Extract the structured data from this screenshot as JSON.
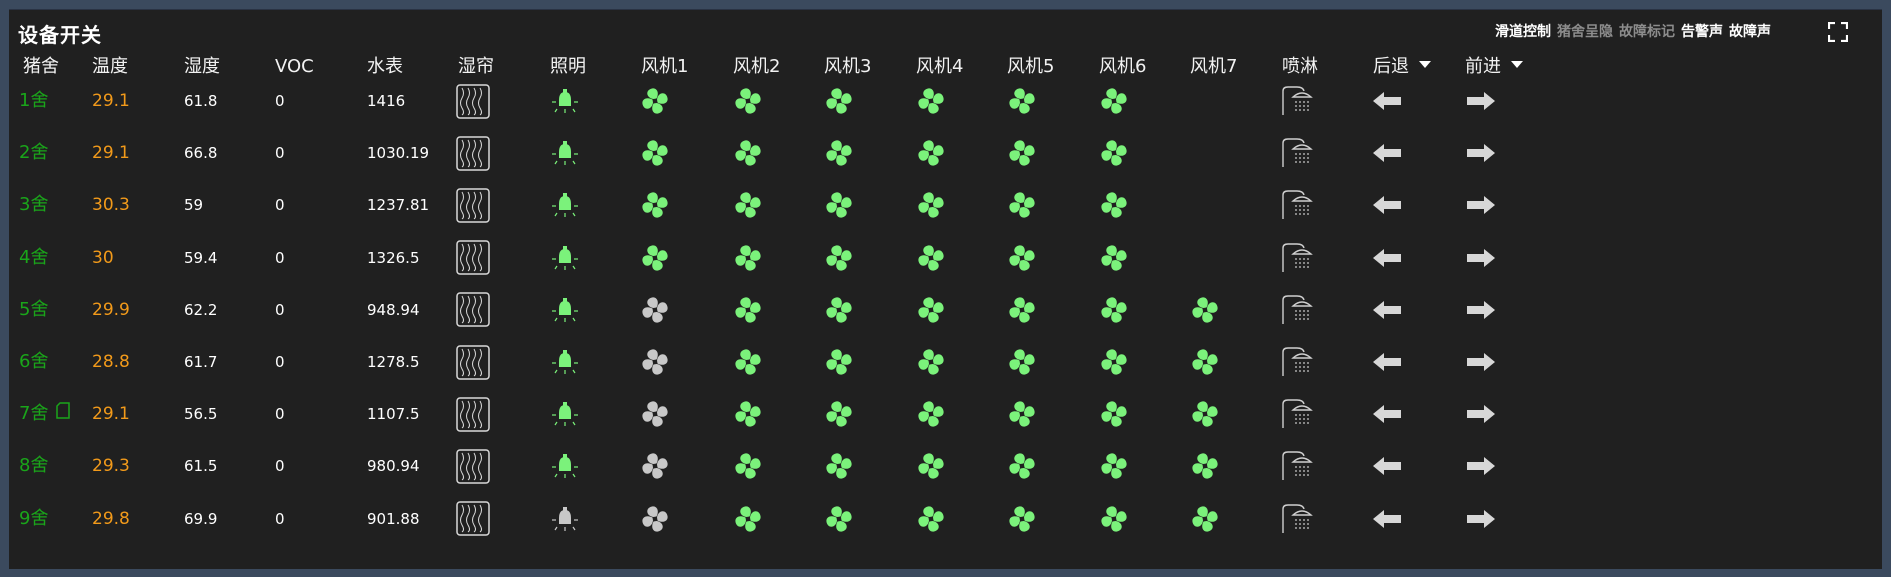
{
  "title": "设备开关",
  "toolbar": {
    "items": [
      {
        "label": "滑道控制",
        "state": "on"
      },
      {
        "label": "猪舍呈隐",
        "state": "off"
      },
      {
        "label": "故障标记",
        "state": "off"
      },
      {
        "label": "告警声",
        "state": "on"
      },
      {
        "label": "故障声",
        "state": "on"
      }
    ],
    "fullscreen_icon": "fullscreen-icon"
  },
  "colors": {
    "background": "#202020",
    "frame": "#3b4a5e",
    "farm_name": "#1aa51a",
    "temperature": "#f29a1a",
    "device_on": "#7bf27b",
    "device_off": "#c8c8c8"
  },
  "headers": {
    "farm": "猪舍",
    "temp": "温度",
    "humidity": "湿度",
    "voc": "VOC",
    "water": "水表",
    "curtain": "湿帘",
    "light": "照明",
    "fan1": "风机1",
    "fan2": "风机2",
    "fan3": "风机3",
    "fan4": "风机4",
    "fan5": "风机5",
    "fan6": "风机6",
    "fan7": "风机7",
    "spray": "喷淋",
    "back": "后退",
    "forward": "前进"
  },
  "rows": [
    {
      "farm": "1舍",
      "temp": "29.1",
      "humidity": "61.8",
      "voc": "0",
      "water": "1416",
      "marker": false,
      "light": "on",
      "fans": [
        "on",
        "on",
        "on",
        "on",
        "on",
        "on",
        null
      ]
    },
    {
      "farm": "2舍",
      "temp": "29.1",
      "humidity": "66.8",
      "voc": "0",
      "water": "1030.19",
      "marker": false,
      "light": "on",
      "fans": [
        "on",
        "on",
        "on",
        "on",
        "on",
        "on",
        null
      ]
    },
    {
      "farm": "3舍",
      "temp": "30.3",
      "humidity": "59",
      "voc": "0",
      "water": "1237.81",
      "marker": false,
      "light": "on",
      "fans": [
        "on",
        "on",
        "on",
        "on",
        "on",
        "on",
        null
      ]
    },
    {
      "farm": "4舍",
      "temp": "30",
      "humidity": "59.4",
      "voc": "0",
      "water": "1326.5",
      "marker": false,
      "light": "on",
      "fans": [
        "on",
        "on",
        "on",
        "on",
        "on",
        "on",
        null
      ]
    },
    {
      "farm": "5舍",
      "temp": "29.9",
      "humidity": "62.2",
      "voc": "0",
      "water": "948.94",
      "marker": false,
      "light": "on",
      "fans": [
        "off",
        "on",
        "on",
        "on",
        "on",
        "on",
        "on"
      ]
    },
    {
      "farm": "6舍",
      "temp": "28.8",
      "humidity": "61.7",
      "voc": "0",
      "water": "1278.5",
      "marker": false,
      "light": "on",
      "fans": [
        "off",
        "on",
        "on",
        "on",
        "on",
        "on",
        "on"
      ]
    },
    {
      "farm": "7舍",
      "temp": "29.1",
      "humidity": "56.5",
      "voc": "0",
      "water": "1107.5",
      "marker": true,
      "light": "on",
      "fans": [
        "off",
        "on",
        "on",
        "on",
        "on",
        "on",
        "on"
      ]
    },
    {
      "farm": "8舍",
      "temp": "29.3",
      "humidity": "61.5",
      "voc": "0",
      "water": "980.94",
      "marker": false,
      "light": "on",
      "fans": [
        "off",
        "on",
        "on",
        "on",
        "on",
        "on",
        "on"
      ]
    },
    {
      "farm": "9舍",
      "temp": "29.8",
      "humidity": "69.9",
      "voc": "0",
      "water": "901.88",
      "marker": false,
      "light": "off",
      "fans": [
        "off",
        "on",
        "on",
        "on",
        "on",
        "on",
        "on"
      ]
    }
  ]
}
